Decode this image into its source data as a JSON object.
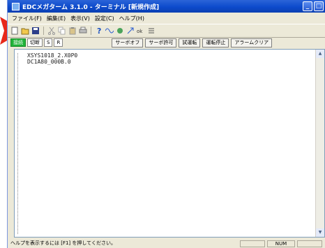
{
  "window": {
    "title": "EDCメガターム 3.1.0 - ターミナル [新規作成]",
    "min_glyph": "_",
    "max_glyph": "□"
  },
  "menu": [
    "ファイル(F)",
    "編集(E)",
    "表示(V)",
    "設定(C)",
    "ヘルプ(H)"
  ],
  "status_tags": [
    {
      "label": "接続",
      "color": "#21b33a"
    },
    {
      "label": "切断"
    },
    {
      "label": "S"
    },
    {
      "label": "R"
    }
  ],
  "command_buttons": [
    "サーボオフ",
    "サーボ許可",
    "試運転",
    "運転停止",
    "アラームクリア"
  ],
  "editor_lines": [
    "XSYS1018_2.X0P0",
    "DC1A80_000B.0"
  ],
  "statusbar": {
    "help_text": "ヘルプを表示するには [F1] を押してください。",
    "num": "NUM"
  },
  "icons": [
    "new-icon",
    "open-icon",
    "save-icon",
    "cut-icon",
    "copy-icon",
    "paste-icon",
    "print-icon",
    "help-icon",
    "wave-icon",
    "servo-icon",
    "arrow-icon",
    "ok-icon",
    "list-icon"
  ],
  "accent": {
    "arrow": "#e8281a",
    "titlebar": "#0d4bcc"
  }
}
